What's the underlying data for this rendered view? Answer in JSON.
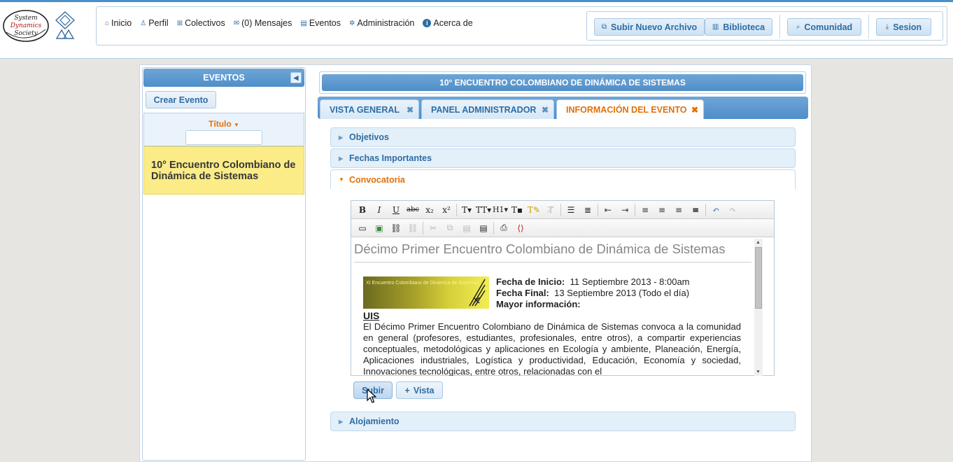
{
  "logo": {
    "line1": "System",
    "line2": "Dynamics",
    "line3": "Society"
  },
  "nav": {
    "links": [
      {
        "label": "Inicio",
        "icon": "home-icon"
      },
      {
        "label": "Perfil",
        "icon": "user-icon"
      },
      {
        "label": "Colectivos",
        "icon": "group-icon"
      },
      {
        "label": "(0) Mensajes",
        "icon": "mail-icon"
      },
      {
        "label": "Eventos",
        "icon": "calendar-icon"
      },
      {
        "label": "Administración",
        "icon": "gear-icon"
      },
      {
        "label": "Acerca de",
        "icon": "info-icon"
      }
    ],
    "actions": {
      "upload": "Subir Nuevo Archivo",
      "library": "Biblioteca",
      "community": "Comunidad",
      "session": "Sesion"
    }
  },
  "sidebar": {
    "header": "EVENTOS",
    "create_button": "Crear Evento",
    "filter_label": "Título",
    "filter_value": "",
    "events": [
      "10° Encuentro Colombiano de Dinámica de Sistemas"
    ]
  },
  "event": {
    "title": "10° ENCUENTRO COLOMBIANO DE DINÁMICA DE SISTEMAS",
    "tabs": [
      {
        "label": "VISTA GENERAL",
        "active": false
      },
      {
        "label": "PANEL ADMINISTRADOR",
        "active": false
      },
      {
        "label": "INFORMACIÓN DEL EVENTO",
        "active": true
      }
    ],
    "sections": [
      "Objetivos",
      "Fechas Importantes",
      "Convocatoria",
      "Alojamiento"
    ],
    "open_section": "Convocatoria"
  },
  "editor": {
    "heading": "Décimo Primer Encuentro Colombiano de Dinámica de Sistemas",
    "banner_text": "XI Encuentro Colombiano de Dinámica de Sistemas",
    "start_label": "Fecha de Inicio:",
    "start_value": "11 Septiembre 2013 - 8:00am",
    "end_label": "Fecha Final:",
    "end_value": "13 Septiembre 2013 (Todo el día)",
    "more_label": "Mayor información:",
    "org": "UIS",
    "paragraph": "El Décimo Primer Encuentro Colombiano de Dinámica de Sistemas convoca a la comunidad en general (profesores, estudiantes, profesionales, entre otros), a compartir experiencias conceptuales, metodológicas y aplicaciones en Ecología y ambiente, Planeación, Energía, Aplicaciones industriales, Logística y productividad, Educación, Economía y sociedad, Innovaciones tecnológicas, entre otros, relacionadas con el",
    "buttons": {
      "submit": "Subir",
      "preview": "Vista"
    }
  },
  "colors": {
    "primary": "#4f8ec9",
    "accent": "#e17009",
    "highlight": "#fbec88"
  }
}
